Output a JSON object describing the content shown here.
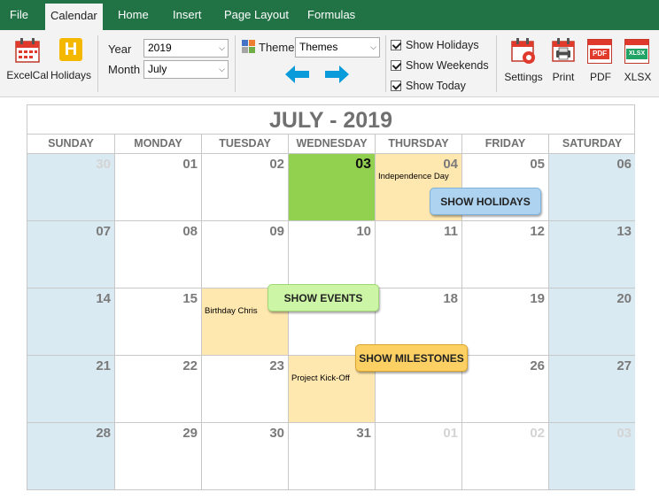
{
  "tabs": [
    {
      "label": "File",
      "active": false
    },
    {
      "label": "Calendar",
      "active": true
    },
    {
      "label": "Home",
      "active": false
    },
    {
      "label": "Insert",
      "active": false
    },
    {
      "label": "Page Layout",
      "active": false
    },
    {
      "label": "Formulas",
      "active": false
    }
  ],
  "ribbon": {
    "excelcal_label": "ExcelCal",
    "holidays_label": "Holidays",
    "year_label": "Year",
    "year_value": "2019",
    "month_label": "Month",
    "month_value": "July",
    "theme_label": "Theme",
    "theme_value": "Themes",
    "show_holidays": "Show Holidays",
    "show_weekends": "Show Weekends",
    "show_today": "Show Today",
    "settings_label": "Settings",
    "print_label": "Print",
    "pdf_label": "PDF",
    "xlsx_label": "XLSX",
    "pdf_icon_text": "PDF",
    "xlsx_icon_text": "XLSX",
    "holidays_icon_text": "H"
  },
  "colors": {
    "ribbon_green": "#217346",
    "weekend": "#daeaf2",
    "today": "#92d050",
    "event": "#ffe8b0",
    "arrow_blue": "#0a9bdb"
  },
  "calendar": {
    "title": "JULY - 2019",
    "weekdays": [
      "SUNDAY",
      "MONDAY",
      "TUESDAY",
      "WEDNESDAY",
      "THURSDAY",
      "FRIDAY",
      "SATURDAY"
    ],
    "weeks": [
      [
        {
          "d": "30",
          "other": true,
          "type": "weekend"
        },
        {
          "d": "01"
        },
        {
          "d": "02"
        },
        {
          "d": "03",
          "type": "today"
        },
        {
          "d": "04",
          "type": "holiday",
          "note": "Independence Day"
        },
        {
          "d": "05"
        },
        {
          "d": "06",
          "type": "weekend"
        }
      ],
      [
        {
          "d": "07",
          "type": "weekend"
        },
        {
          "d": "08"
        },
        {
          "d": "09"
        },
        {
          "d": "10"
        },
        {
          "d": "11"
        },
        {
          "d": "12"
        },
        {
          "d": "13",
          "type": "weekend"
        }
      ],
      [
        {
          "d": "14",
          "type": "weekend"
        },
        {
          "d": "15"
        },
        {
          "d": "16",
          "type": "event",
          "note": "Birthday Chris",
          "hide_num": true
        },
        {
          "d": "17",
          "hide_num": true
        },
        {
          "d": "18"
        },
        {
          "d": "19"
        },
        {
          "d": "20",
          "type": "weekend"
        }
      ],
      [
        {
          "d": "21",
          "type": "weekend"
        },
        {
          "d": "22"
        },
        {
          "d": "23"
        },
        {
          "d": "24",
          "type": "milestone",
          "note": "Project Kick-Off",
          "hide_num": true
        },
        {
          "d": "25",
          "hide_num": true
        },
        {
          "d": "26"
        },
        {
          "d": "27",
          "type": "weekend"
        }
      ],
      [
        {
          "d": "28",
          "type": "weekend"
        },
        {
          "d": "29"
        },
        {
          "d": "30"
        },
        {
          "d": "31"
        },
        {
          "d": "01",
          "other": true
        },
        {
          "d": "02",
          "other": true
        },
        {
          "d": "03",
          "other": true,
          "type": "weekend"
        }
      ]
    ]
  },
  "callouts": {
    "holidays": "SHOW HOLIDAYS",
    "events": "SHOW EVENTS",
    "milestones": "SHOW MILESTONES"
  }
}
